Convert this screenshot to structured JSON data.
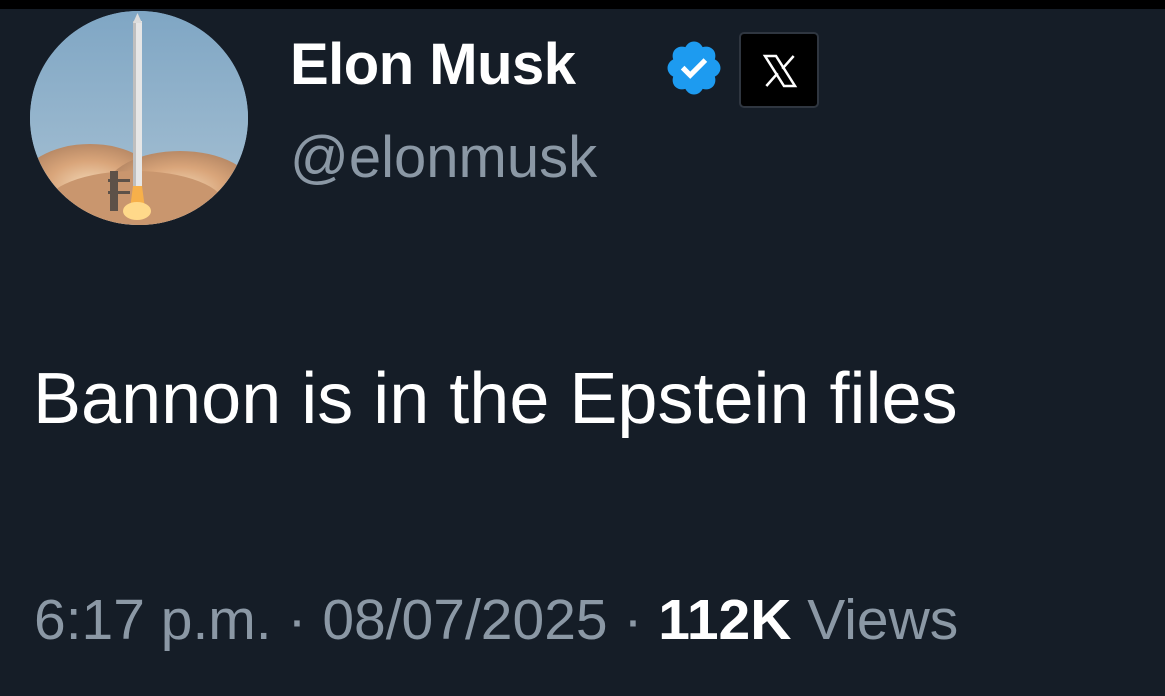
{
  "author": {
    "display_name": "Elon Musk",
    "handle": "@elonmusk",
    "verified_icon": "verified-badge-icon",
    "affiliate_icon": "x-logo-icon"
  },
  "tweet": {
    "text": "Bannon is in the Epstein files"
  },
  "meta": {
    "time": "6:17 p.m.",
    "separator": "·",
    "date": "08/07/2025",
    "views_count": "112K",
    "views_label": "Views"
  },
  "colors": {
    "background": "#151d27",
    "primary_text": "#ffffff",
    "secondary_text": "#8b98a5",
    "verified_blue": "#1d9bf0"
  }
}
